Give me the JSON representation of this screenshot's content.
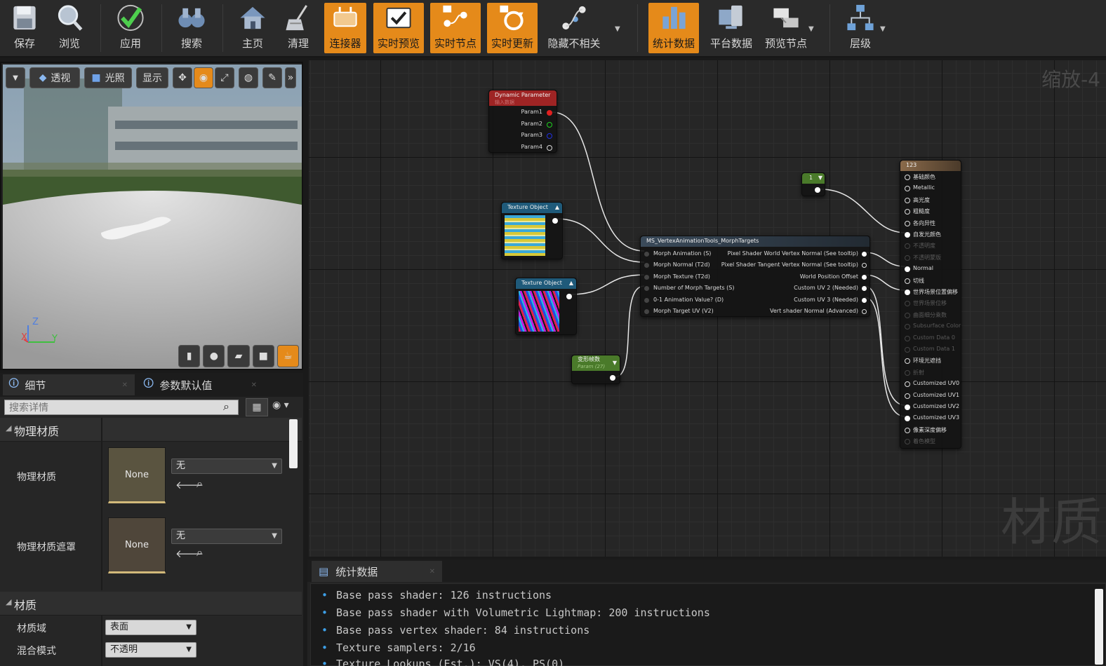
{
  "toolbar": {
    "buttons": [
      {
        "label": "保存",
        "icon": "save-icon",
        "active": false
      },
      {
        "label": "浏览",
        "icon": "browse-icon",
        "active": false
      },
      {
        "label": "应用",
        "icon": "apply-icon",
        "active": false
      },
      {
        "label": "搜索",
        "icon": "search-binoculars-icon",
        "active": false
      },
      {
        "label": "主页",
        "icon": "home-icon",
        "active": false
      },
      {
        "label": "清理",
        "icon": "clean-icon",
        "active": false
      },
      {
        "label": "连接器",
        "icon": "connector-icon",
        "active": true
      },
      {
        "label": "实时预览",
        "icon": "live-preview-icon",
        "active": true
      },
      {
        "label": "实时节点",
        "icon": "live-nodes-icon",
        "active": true
      },
      {
        "label": "实时更新",
        "icon": "live-update-icon",
        "active": true
      },
      {
        "label": "隐藏不相关",
        "icon": "hide-unrelated-icon",
        "active": false
      },
      {
        "label": "统计数据",
        "icon": "stats-icon",
        "active": true
      },
      {
        "label": "平台数据",
        "icon": "platform-stats-icon",
        "active": false
      },
      {
        "label": "预览节点",
        "icon": "preview-node-icon",
        "active": false
      },
      {
        "label": "层级",
        "icon": "hierarchy-icon",
        "active": false
      }
    ]
  },
  "viewport": {
    "tools": {
      "perspective": "透视",
      "lit": "光照",
      "show": "显示"
    },
    "axis": {
      "x": "X",
      "y": "Y",
      "z": "Z"
    }
  },
  "details": {
    "tabs": [
      {
        "label": "细节"
      },
      {
        "label": "参数默认值"
      }
    ],
    "search_placeholder": "搜索详情",
    "sections": {
      "physical": "物理材质",
      "material": "材质"
    },
    "phys_material": {
      "label": "物理材质",
      "thumb": "None",
      "value": "无"
    },
    "phys_mask": {
      "label": "物理材质遮罩",
      "thumb": "None",
      "value": "无"
    },
    "material_domain": {
      "label": "材质域",
      "value": "表面"
    },
    "blend_mode": {
      "label": "混合模式",
      "value": "不透明"
    }
  },
  "graph": {
    "watermark_zoom": "缩放-4",
    "watermark_title": "材质",
    "dynamic_param": {
      "title": "Dynamic Parameter",
      "subtitle": "输入数据",
      "pins": [
        "Param1",
        "Param2",
        "Param3",
        "Param4"
      ]
    },
    "texture1": {
      "title": "Texture Object"
    },
    "texture2": {
      "title": "Texture Object"
    },
    "constant": {
      "value": "1"
    },
    "scalar_param": {
      "title": "变形帧数",
      "subtitle": "Param (27)"
    },
    "morph_node": {
      "title": "MS_VertexAnimationTools_MorphTargets",
      "inputs": [
        "Morph Animation (S)",
        "Morph Normal (T2d)",
        "Morph Texture (T2d)",
        "Number of Morph Targets (S)",
        "0-1 Animation Value? (D)",
        "Morph Target UV (V2)"
      ],
      "outputs": [
        "Pixel Shader World Vertex Normal (See tooltip)",
        "Pixel Shader Tangent Vertex Normal (See tooltip)",
        "World Position Offset",
        "Custom UV 2 (Needed)",
        "Custom UV 3 (Needed)",
        "Vert shader Normal (Advanced)"
      ]
    },
    "result_node": {
      "title": "123",
      "pins": [
        {
          "label": "基础颜色",
          "enabled": true
        },
        {
          "label": "Metallic",
          "enabled": true
        },
        {
          "label": "高光度",
          "enabled": true
        },
        {
          "label": "粗糙度",
          "enabled": true
        },
        {
          "label": "各向异性",
          "enabled": true
        },
        {
          "label": "自发光颜色",
          "enabled": true
        },
        {
          "label": "不透明度",
          "enabled": false
        },
        {
          "label": "不透明蒙版",
          "enabled": false
        },
        {
          "label": "Normal",
          "enabled": true
        },
        {
          "label": "切线",
          "enabled": true
        },
        {
          "label": "世界场景位置偏移",
          "enabled": true
        },
        {
          "label": "世界场景位移",
          "enabled": false
        },
        {
          "label": "曲面细分乘数",
          "enabled": false
        },
        {
          "label": "Subsurface Color",
          "enabled": false
        },
        {
          "label": "Custom Data 0",
          "enabled": false
        },
        {
          "label": "Custom Data 1",
          "enabled": false
        },
        {
          "label": "环境光遮挡",
          "enabled": true
        },
        {
          "label": "折射",
          "enabled": false
        },
        {
          "label": "Customized UV0",
          "enabled": true
        },
        {
          "label": "Customized UV1",
          "enabled": true
        },
        {
          "label": "Customized UV2",
          "enabled": true
        },
        {
          "label": "Customized UV3",
          "enabled": true
        },
        {
          "label": "像素深度偏移",
          "enabled": true
        },
        {
          "label": "着色模型",
          "enabled": false
        }
      ]
    }
  },
  "stats": {
    "tab": "统计数据",
    "lines": [
      "Base pass shader: 126 instructions",
      "Base pass shader with Volumetric Lightmap: 200 instructions",
      "Base pass vertex shader: 84 instructions",
      "Texture samplers: 2/16",
      "Texture Lookups (Est.): VS(4), PS(0)"
    ]
  },
  "colors": {
    "accent": "#e58a1a",
    "panel": "#262626",
    "bullet": "#3da0e8"
  }
}
